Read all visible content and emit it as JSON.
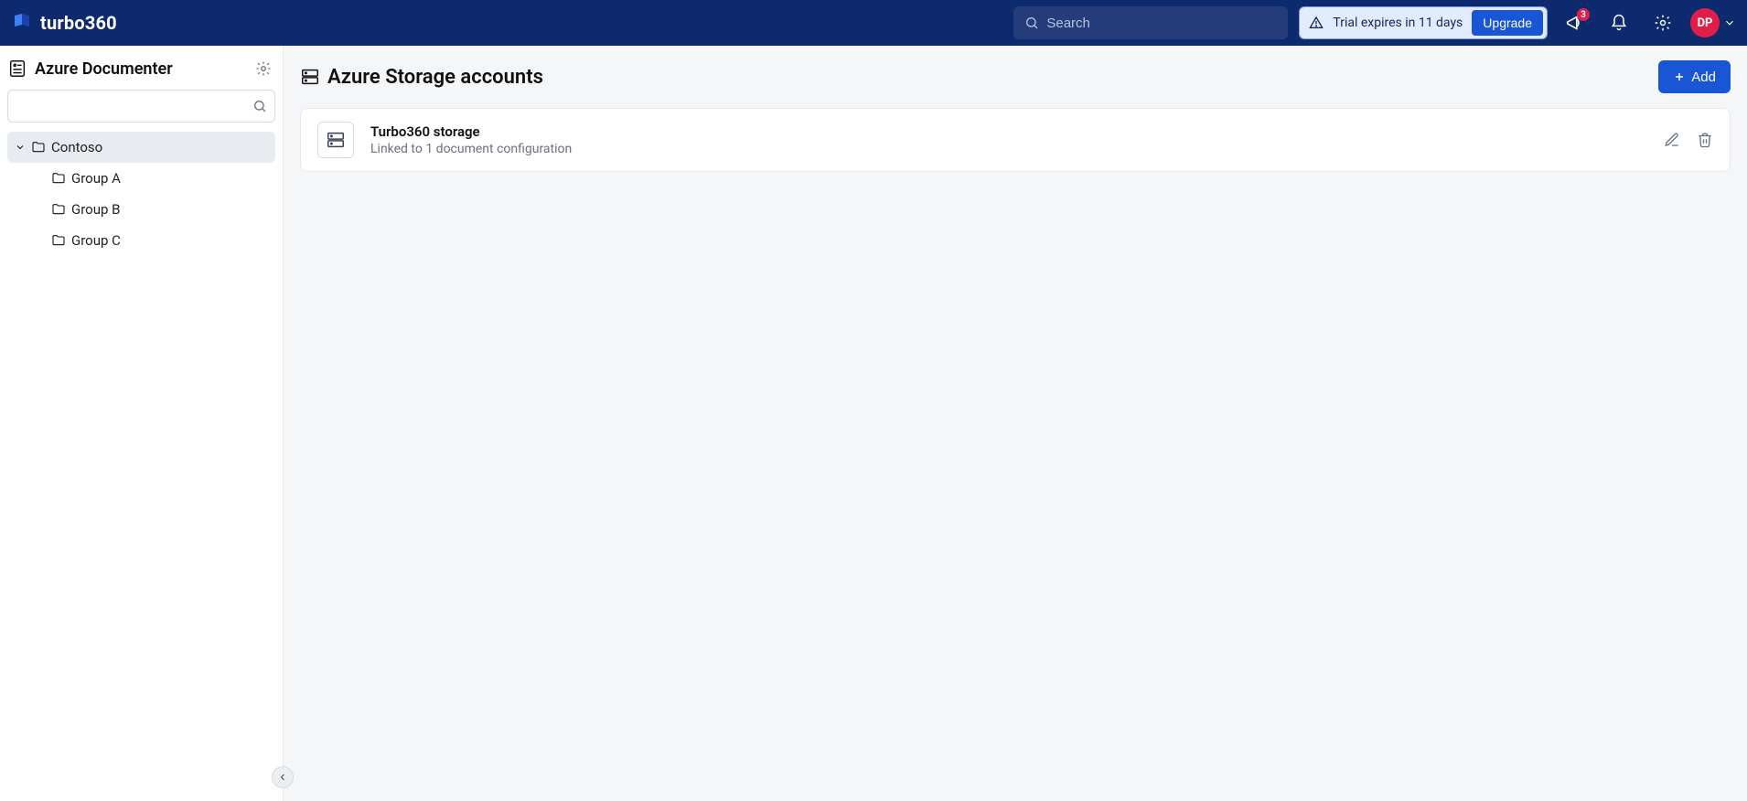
{
  "header": {
    "logo_text": "turbo360",
    "search_placeholder": "Search",
    "trial_text": "Trial expires in 11 days",
    "upgrade_label": "Upgrade",
    "announce_badge": "3",
    "avatar_initials": "DP"
  },
  "sidebar": {
    "title": "Azure Documenter",
    "tree": {
      "root": {
        "label": "Contoso",
        "expanded": true
      },
      "children": [
        {
          "label": "Group A"
        },
        {
          "label": "Group B"
        },
        {
          "label": "Group C"
        }
      ]
    }
  },
  "main": {
    "title": "Azure Storage accounts",
    "add_label": "Add",
    "items": [
      {
        "title": "Turbo360 storage",
        "subtitle": "Linked to 1 document configuration"
      }
    ]
  }
}
